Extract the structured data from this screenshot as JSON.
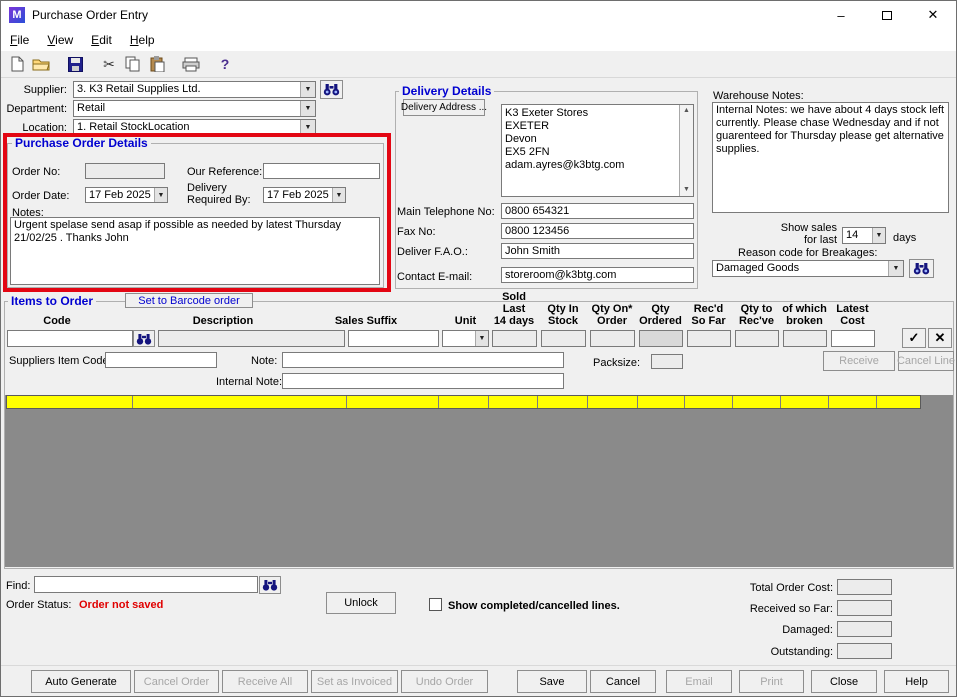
{
  "window": {
    "title": "Purchase Order Entry",
    "logo_letter": "M"
  },
  "icons": {
    "minimize": "–",
    "close": "✕",
    "dropdown_arrow": "▼",
    "scroll_up": "▲",
    "scroll_down": "▼",
    "scissors": "✂",
    "help_question": "?",
    "check": "✓",
    "cancel_x": "✕"
  },
  "menu": {
    "items": [
      "File",
      "View",
      "Edit",
      "Help"
    ]
  },
  "header": {
    "supplier_label": "Supplier:",
    "supplier_value": "3.  K3 Retail Supplies Ltd.",
    "department_label": "Department:",
    "department_value": "Retail",
    "location_label": "Location:",
    "location_value": "1. Retail StockLocation"
  },
  "po_details": {
    "title": "Purchase Order Details",
    "order_no_label": "Order No:",
    "our_reference_label": "Our Reference:",
    "order_date_label": "Order Date:",
    "order_date_value": "17 Feb 2025",
    "delivery_required_label": "Delivery\nRequired By:",
    "delivery_required_value": "17 Feb 2025",
    "notes_label": "Notes:",
    "notes_value": "Urgent spelase send asap if possible as needed by latest Thursday 21/02/25 . Thanks John"
  },
  "delivery": {
    "title": "Delivery Details",
    "address_button": "Delivery Address ...",
    "address_value": "K3 Exeter Stores\nEXETER\nDevon\nEX5 2FN\nadam.ayres@k3btg.com",
    "phone_label": "Main Telephone No:",
    "phone_value": "0800 654321",
    "fax_label": "Fax No:",
    "fax_value": "0800 123456",
    "fao_label": "Deliver F.A.O.:",
    "fao_value": "John Smith",
    "email_label": "Contact E-mail:",
    "email_value": "storeroom@k3btg.com"
  },
  "warehouse": {
    "notes_label": "Warehouse Notes:",
    "notes_value": "Internal Notes: we have about 4 days stock left currently. Please chase Wednesday and if not guarenteed for Thursday please get alternative supplies.",
    "show_sales_label": "Show sales\nfor last",
    "show_sales_value": "14",
    "days_label": "days",
    "breakage_label": "Reason code for Breakages:",
    "breakage_value": "Damaged Goods"
  },
  "items": {
    "title": "Items to Order",
    "barcode_button": "Set to Barcode order",
    "columns": [
      {
        "line1": "",
        "line2": "Code"
      },
      {
        "line1": "",
        "line2": "Description"
      },
      {
        "line1": "",
        "line2": "Sales Suffix"
      },
      {
        "line1": "",
        "line2": "Unit"
      },
      {
        "line1": "Sold Last",
        "line2": "14 days"
      },
      {
        "line1": "Qty In",
        "line2": "Stock"
      },
      {
        "line1": "Qty On*",
        "line2": "Order"
      },
      {
        "line1": "Qty",
        "line2": "Ordered"
      },
      {
        "line1": "Rec'd",
        "line2": "So Far"
      },
      {
        "line1": "Qty to",
        "line2": "Rec've"
      },
      {
        "line1": "of which",
        "line2": "broken"
      },
      {
        "line1": "Latest",
        "line2": "Cost"
      }
    ],
    "suppliers_item_code_label": "Suppliers Item Code:",
    "note_label": "Note:",
    "internal_note_label": "Internal Note:",
    "packsize_label": "Packsize:",
    "receive_button": "Receive",
    "cancel_line_button": "Cancel Line"
  },
  "footer": {
    "find_label": "Find:",
    "order_status_label": "Order Status:",
    "order_status_value": "Order not saved",
    "unlock_button": "Unlock",
    "show_completed_label": "Show completed/cancelled lines.",
    "total_order_cost_label": "Total Order Cost:",
    "received_so_far_label": "Received so Far:",
    "damaged_label": "Damaged:",
    "outstanding_label": "Outstanding:"
  },
  "bottom_buttons": [
    {
      "label": "Auto Generate"
    },
    {
      "label": "Cancel Order"
    },
    {
      "label": "Receive All"
    },
    {
      "label": "Set as Invoiced"
    },
    {
      "label": "Undo Order"
    },
    {
      "label": "Save"
    },
    {
      "label": "Cancel"
    },
    {
      "label": "Email"
    },
    {
      "label": "Print"
    },
    {
      "label": "Close"
    },
    {
      "label": "Help"
    }
  ]
}
